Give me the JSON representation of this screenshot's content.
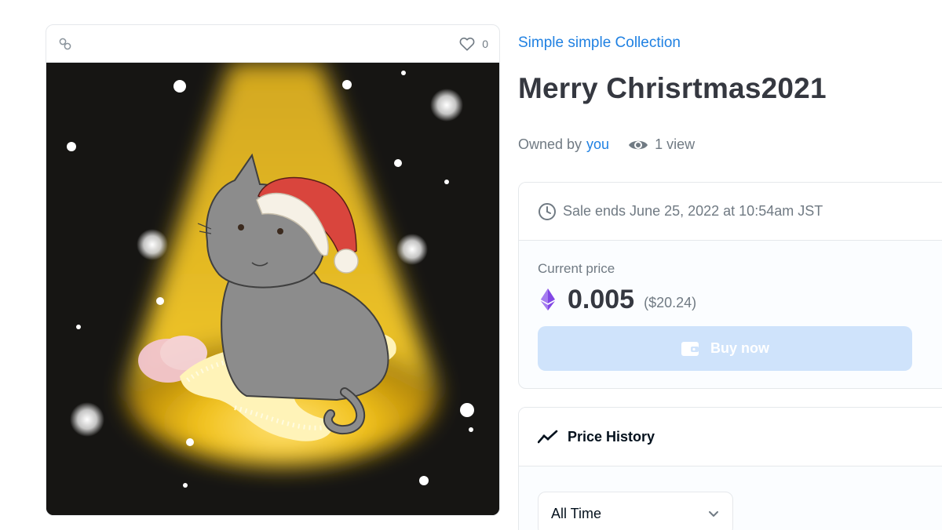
{
  "asset": {
    "favorites_count": "0",
    "image_alt": "Gray cat wearing a Santa hat sitting on gold tinsel under a spotlight with falling snow"
  },
  "collection": {
    "name": "Simple simple Collection"
  },
  "item": {
    "title": "Merry Chrisrtmas2021"
  },
  "ownership": {
    "owned_by_label": "Owned by",
    "owner": "you",
    "views": "1 view"
  },
  "sale": {
    "ends_text": "Sale ends June 25, 2022 at 10:54am JST",
    "current_price_label": "Current price",
    "price": "0.005",
    "price_usd": "($20.24)",
    "buy_label": "Buy now"
  },
  "price_history": {
    "title": "Price History",
    "period_selected": "All Time"
  },
  "icons": {
    "chain": "chain-link-icon",
    "favorite": "heart-icon",
    "views": "eye-icon",
    "clock": "clock-icon",
    "currency": "ethereum-icon",
    "buy": "wallet-icon",
    "history": "trending-line-icon",
    "dropdown": "chevron-down-icon"
  },
  "colors": {
    "link": "#2081e2",
    "buy_button_disabled": "#cfe3fb",
    "eth": "#8247e5"
  }
}
